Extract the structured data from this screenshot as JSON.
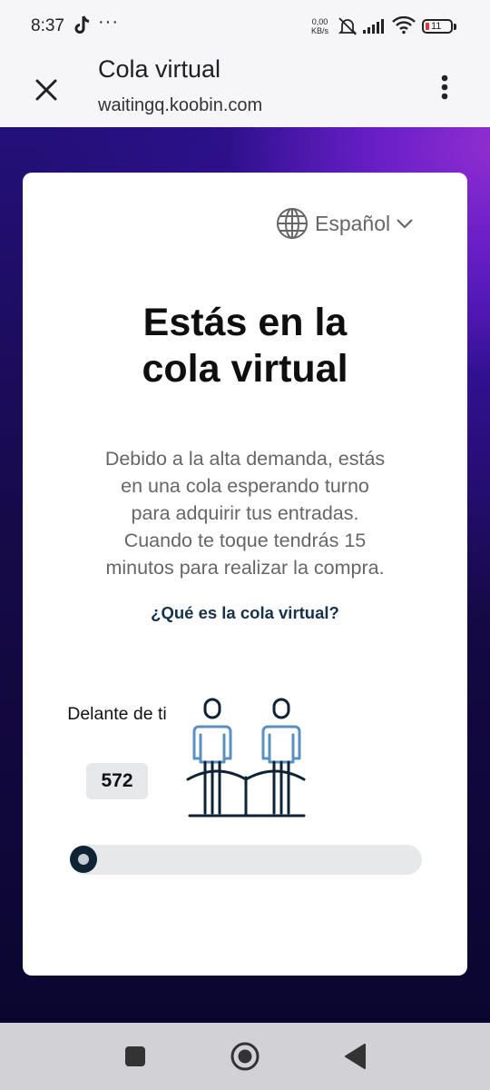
{
  "status_bar": {
    "time": "8:37",
    "dots": "···",
    "net_speed_value": "0,00",
    "net_speed_unit": "KB/s",
    "battery": "11",
    "battery_low_color": "#e5333b"
  },
  "browser": {
    "title": "Cola virtual",
    "url": "waitingq.koobin.com"
  },
  "card": {
    "language": "Español",
    "headline_line1": "Estás en la",
    "headline_line2": "cola virtual",
    "description_lines": [
      "Debido a la alta demanda, estás",
      "en una cola esperando turno",
      "para adquirir tus entradas.",
      "Cuando te toque tendrás 15",
      "minutos para realizar la compra."
    ],
    "info_link": "¿Qué es la cola virtual?",
    "ahead_label": "Delante de ti",
    "ahead_count": "572",
    "progress_fraction": 0.0
  },
  "icons": {
    "close": "close-icon",
    "menu": "more-vertical-icon",
    "globe": "globe-icon",
    "chevron": "chevron-down-icon",
    "nav_recents": "square-icon",
    "nav_home": "home-circle-icon",
    "nav_back": "back-triangle-icon"
  },
  "colors": {
    "accent_dark": "#0e2334",
    "person_blue": "#5b8fc0",
    "link": "#16324a",
    "gradient_purple": "#8f2ed1",
    "gradient_navy": "#160a48"
  }
}
